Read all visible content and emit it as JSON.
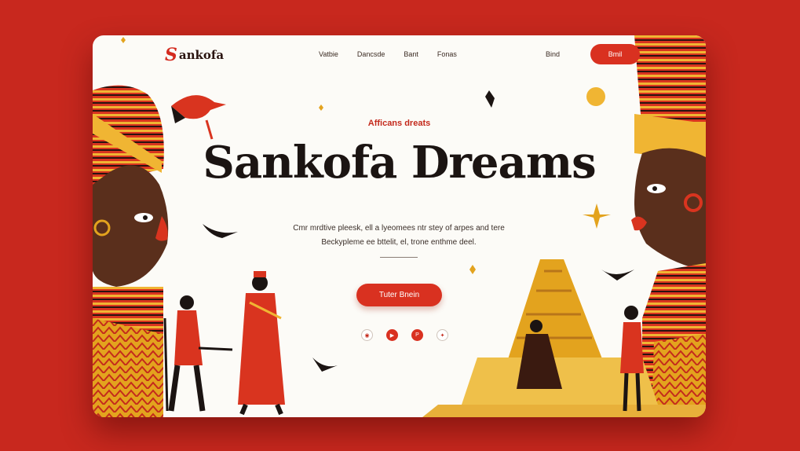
{
  "brand": {
    "logo_mark": "S",
    "logo_text": "ankofa"
  },
  "nav": {
    "links": [
      "Vatbie",
      "Dancsde",
      "Bant",
      "Fonas"
    ],
    "extra_link": "Bind",
    "cta_label": "Bmil"
  },
  "hero": {
    "eyebrow": "Afficans dreats",
    "title": "Sankofa Dreams",
    "description_line1": "Cmr mrdtive pleesk, ell a lyeomees ntr stey of arpes and tere",
    "description_line2": "Beckypleme ee bttelit, el, trone enthme deel.",
    "cta_label": "Tuter Bnein"
  },
  "socials": [
    {
      "icon": "circle-icon",
      "glyph": "◉"
    },
    {
      "icon": "play-icon",
      "glyph": "▶"
    },
    {
      "icon": "pinterest-icon",
      "glyph": "P"
    },
    {
      "icon": "star-icon",
      "glyph": "✦"
    }
  ],
  "colors": {
    "background": "#c8281e",
    "accent": "#d93120",
    "gold": "#e3a31e",
    "ink": "#1b1412"
  }
}
